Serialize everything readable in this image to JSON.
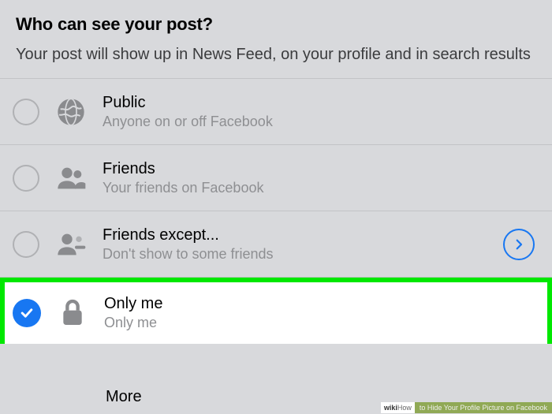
{
  "header": {
    "title": "Who can see your post?",
    "subtitle": "Your post will show up in News Feed, on your profile and in search results"
  },
  "options": [
    {
      "id": "public",
      "icon": "globe-icon",
      "label": "Public",
      "description": "Anyone on or off Facebook",
      "selected": false,
      "hasChevron": false
    },
    {
      "id": "friends",
      "icon": "friends-icon",
      "label": "Friends",
      "description": "Your friends on Facebook",
      "selected": false,
      "hasChevron": false
    },
    {
      "id": "friends-except",
      "icon": "friends-minus-icon",
      "label": "Friends except...",
      "description": "Don't show to some friends",
      "selected": false,
      "hasChevron": true
    },
    {
      "id": "only-me",
      "icon": "lock-icon",
      "label": "Only me",
      "description": "Only me",
      "selected": true,
      "hasChevron": false
    }
  ],
  "more": {
    "label": "More"
  },
  "footer": {
    "brand_a": "wiki",
    "brand_b": "How",
    "article": "to Hide Your Profile Picture on Facebook"
  },
  "colors": {
    "accent": "#1877f2",
    "highlight": "#00e800",
    "muted": "#8a8b8e"
  }
}
